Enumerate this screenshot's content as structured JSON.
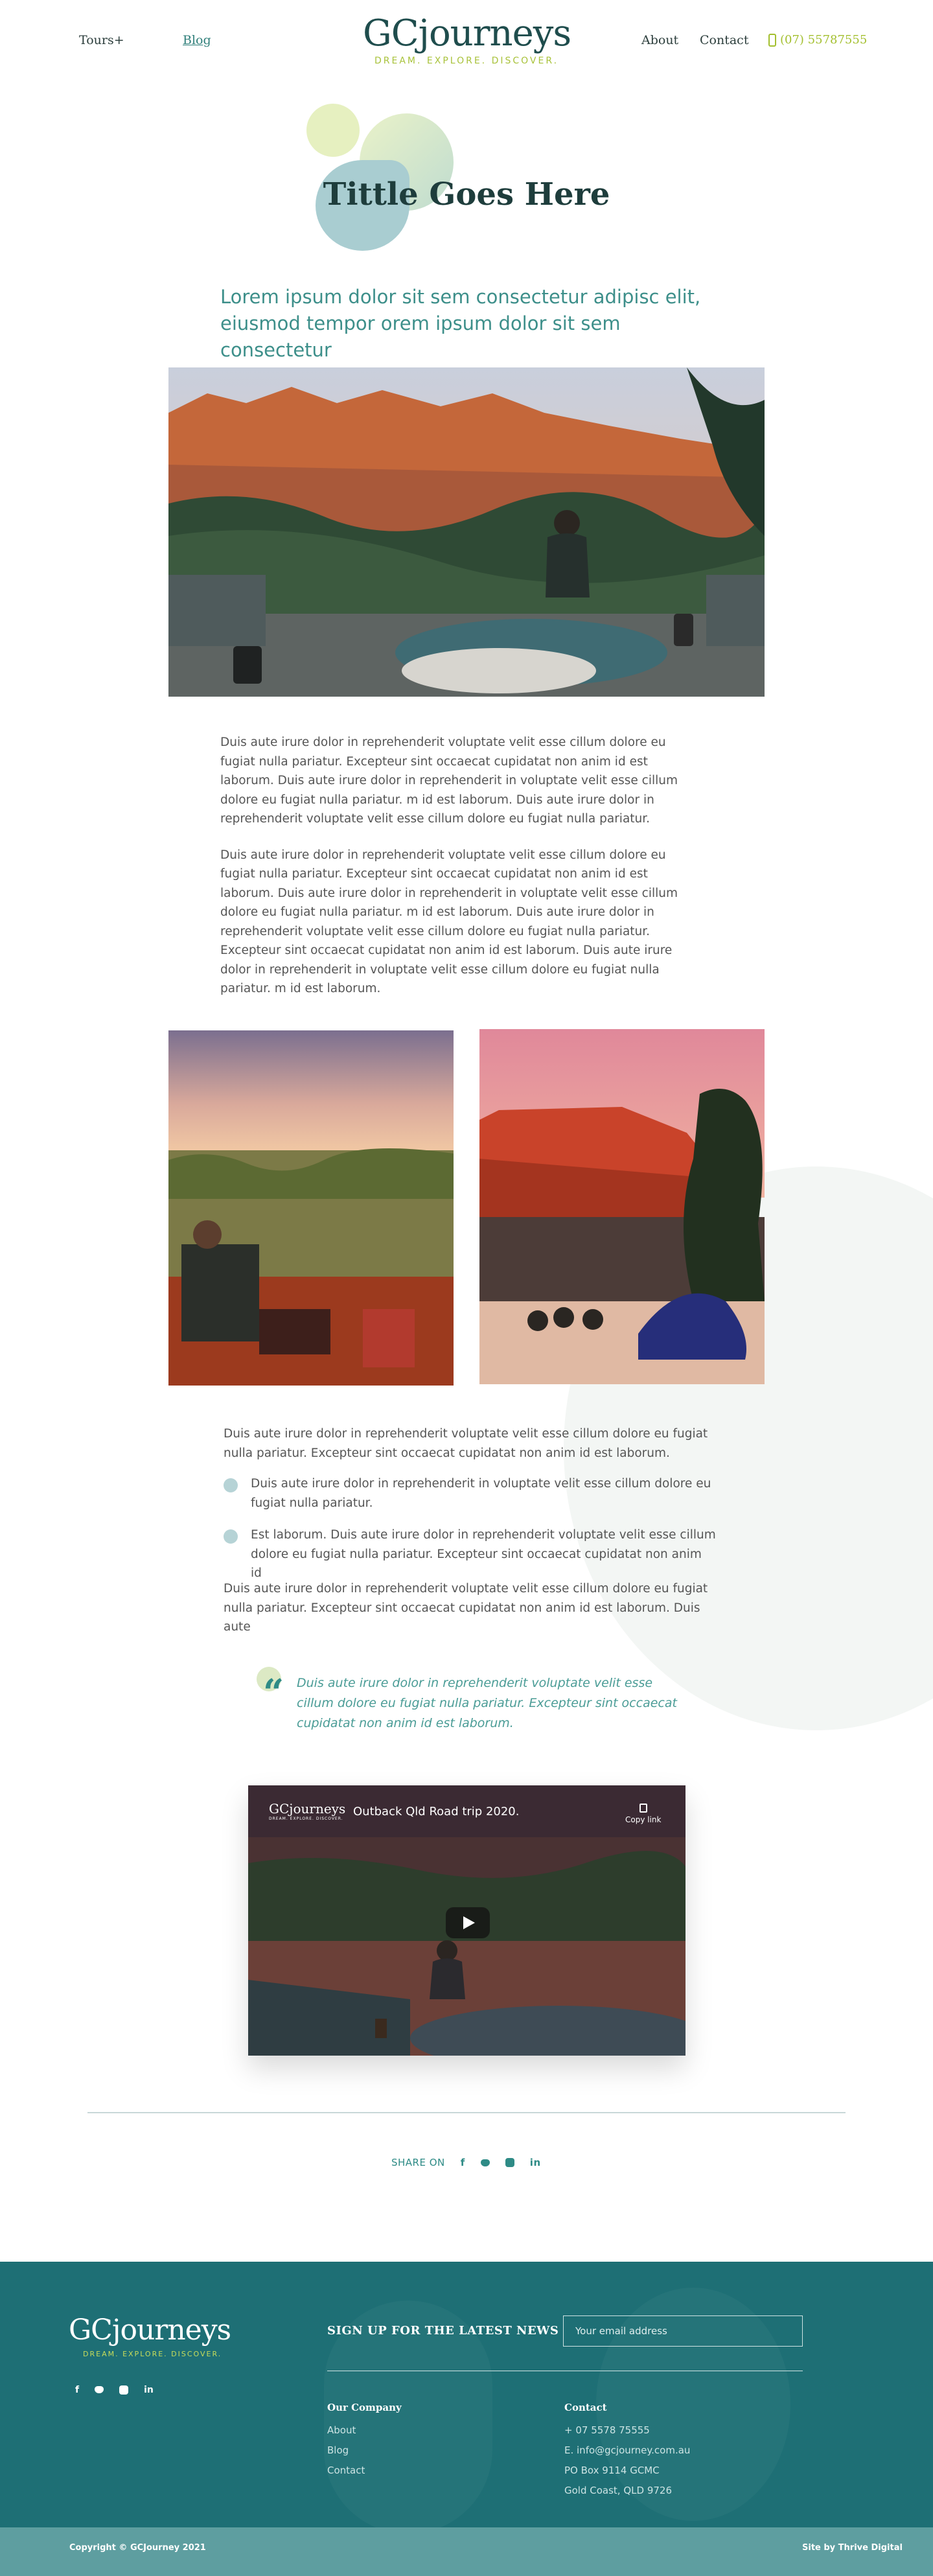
{
  "header": {
    "tours_label": "Tours+",
    "blog_label": "Blog",
    "logo_text": "GCjourneys",
    "logo_tagline": "DREAM. EXPLORE. DISCOVER.",
    "about_label": "About",
    "contact_label": "Contact",
    "phone": "(07) 55787555"
  },
  "article": {
    "title": "Tittle Goes Here",
    "lead": "Lorem ipsum dolor sit   sem consectetur adipisc elit, eiusmod tempor orem ipsum dolor sit  sem consectetur",
    "paragraph_1": "Duis aute irure dolor in reprehenderit  voluptate velit esse cillum dolore eu fugiat nulla pariatur. Excepteur sint occaecat cupidatat non  anim id est laborum. Duis aute irure dolor in reprehenderit in voluptate velit esse cillum dolore eu fugiat nulla pariatur.  m id est laborum.  Duis aute irure dolor in reprehenderit  voluptate velit esse cillum dolore eu fugiat nulla pariatur.",
    "paragraph_2": "Duis aute irure dolor in reprehenderit  voluptate velit esse cillum dolore eu fugiat nulla pariatur. Excepteur sint occaecat cupidatat non  anim id est laborum. Duis aute irure dolor in reprehenderit in voluptate velit esse cillum dolore eu fugiat nulla pariatur.  m id est laborum.  Duis aute irure dolor in reprehenderit  voluptate velit esse cillum dolore eu fugiat nulla pariatur. Excepteur sint occaecat cupidatat non  anim id est laborum. Duis aute irure dolor in reprehenderit in voluptate velit esse cillum dolore eu fugiat nulla pariatur.  m id est laborum.",
    "paragraph_3": "Duis aute irure dolor in reprehenderit  voluptate velit esse cillum dolore eu fugiat nulla pariatur. Excepteur sint occaecat cupidatat non  anim id est laborum.",
    "bullet_1": "Duis aute irure dolor in reprehenderit in voluptate velit esse cillum dolore eu fugiat nulla pariatur.",
    "bullet_2": "Est laborum.  Duis aute irure dolor in reprehenderit  voluptate velit esse cillum dolore eu fugiat nulla pariatur. Excepteur sint occaecat cupidatat non  anim id",
    "paragraph_4": "Duis aute irure dolor in reprehenderit  voluptate velit esse cillum dolore eu fugiat nulla pariatur. Excepteur sint occaecat cupidatat non  anim id est laborum. Duis aute",
    "quote": "Duis aute irure dolor in reprehenderit  voluptate velit esse cillum dolore eu fugiat nulla pariatur. Excepteur sint occaecat cupidatat non anim id est laborum."
  },
  "video": {
    "logo_text": "GCjourneys",
    "logo_tagline": "DREAM. EXPLORE. DISCOVER.",
    "title": "Outback Qld Road trip 2020.",
    "copy_link": "Copy link"
  },
  "share": {
    "label": "SHARE ON",
    "icons": [
      "facebook-icon",
      "twitter-icon",
      "instagram-icon",
      "linkedin-icon"
    ]
  },
  "footer": {
    "logo_text": "GCjourneys",
    "logo_tagline": "DREAM. EXPLORE. DISCOVER.",
    "signup_heading": "SIGN UP FOR THE LATEST NEWS",
    "email_placeholder": "Your email address",
    "company_heading": "Our Company",
    "company_links": [
      "About",
      "Blog",
      "Contact"
    ],
    "contact_heading": "Contact",
    "contact_lines": [
      "+ 07 5578 75555",
      "E. info@gcjourney.com.au",
      "PO Box 9114 GCMC",
      "Gold Coast, QLD 9726"
    ],
    "copyright": "Copyright © GCJourney 2021",
    "site_by": "Site by Thrive Digital"
  },
  "colors": {
    "brand_teal": "#1e6f75",
    "brand_lime": "#a8c23a",
    "heading_dark": "#1e3d3c",
    "lead_teal": "#3d8f8a"
  }
}
